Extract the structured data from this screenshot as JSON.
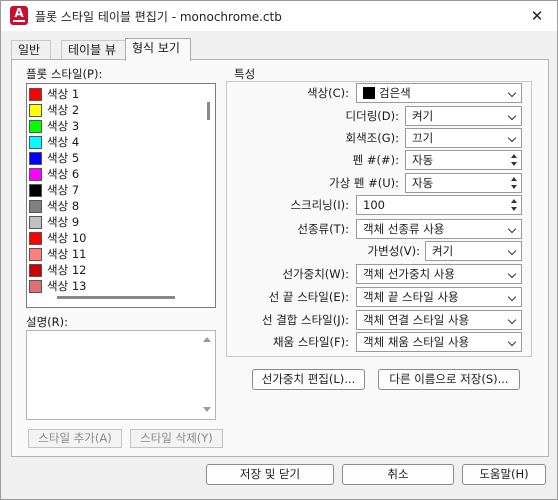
{
  "window": {
    "title": "플롯 스타일 테이블 편집기 - monochrome.ctb",
    "app_icon": "A",
    "close": "✕"
  },
  "tabs": [
    {
      "label": "일반"
    },
    {
      "label": "테이블 뷰"
    },
    {
      "label": "형식 보기"
    }
  ],
  "left": {
    "plot_styles_label": "플롯 스타일(P):",
    "styles": [
      {
        "label": "색상 1",
        "color": "#ff0000"
      },
      {
        "label": "색상 2",
        "color": "#ffff00"
      },
      {
        "label": "색상 3",
        "color": "#00ff00"
      },
      {
        "label": "색상 4",
        "color": "#00ffff"
      },
      {
        "label": "색상 5",
        "color": "#0000ff"
      },
      {
        "label": "색상 6",
        "color": "#ff00ff"
      },
      {
        "label": "색상 7",
        "color": "#000000"
      },
      {
        "label": "색상 8",
        "color": "#808080"
      },
      {
        "label": "색상 9",
        "color": "#c0c0c0"
      },
      {
        "label": "색상 10",
        "color": "#ff0000"
      },
      {
        "label": "색상 11",
        "color": "#ff7f7f"
      },
      {
        "label": "색상 12",
        "color": "#cc0000"
      },
      {
        "label": "색상 13",
        "color": "#e07070"
      }
    ],
    "description_label": "설명(R):",
    "description_value": "",
    "add_style_label": "스타일 추가(A)",
    "delete_style_label": "스타일 삭제(Y)"
  },
  "properties": {
    "group_label": "특성",
    "color_label": "색상(C):",
    "color_value": "검은색",
    "dither_label": "디더링(D):",
    "dither_value": "켜기",
    "grayscale_label": "회색조(G):",
    "grayscale_value": "끄기",
    "pen_label": "펜 #(#):",
    "pen_value": "자동",
    "virtual_pen_label": "가상 펜 #(U):",
    "virtual_pen_value": "자동",
    "screening_label": "스크리닝(I):",
    "screening_value": "100",
    "linetype_label": "선종류(T):",
    "linetype_value": "객체 선종류 사용",
    "adaptive_label": "가변성(V):",
    "adaptive_value": "켜기",
    "lineweight_label": "선가중치(W):",
    "lineweight_value": "객체 선가중치 사용",
    "line_end_label": "선 끝 스타일(E):",
    "line_end_value": "객체 끝 스타일 사용",
    "line_join_label": "선 결합 스타일(J):",
    "line_join_value": "객체 연결 스타일 사용",
    "fill_label": "채움 스타일(F):",
    "fill_value": "객체 채움 스타일 사용"
  },
  "buttons": {
    "edit_lineweights": "선가중치 편집(L)...",
    "save_as": "다른 이름으로 저장(S)...",
    "save_close": "저장 및 닫기",
    "cancel": "취소",
    "help": "도움말(H)"
  }
}
